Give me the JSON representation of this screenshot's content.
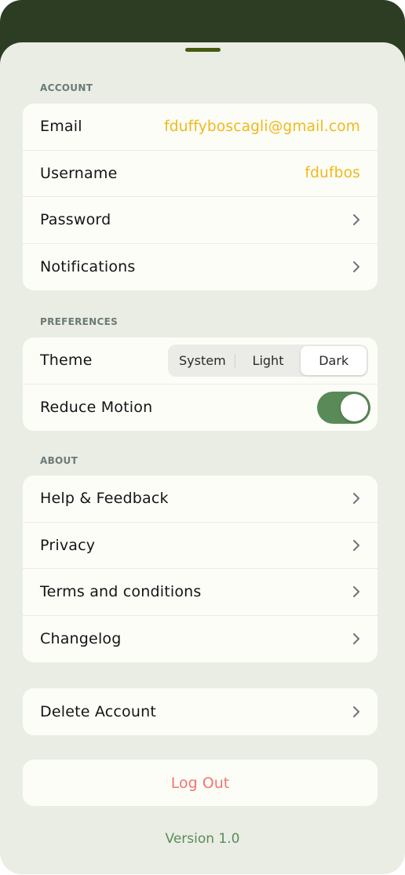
{
  "sections": {
    "account": {
      "title": "ACCOUNT",
      "rows": [
        {
          "label": "Email",
          "value": "fduffyboscagli@gmail.com"
        },
        {
          "label": "Username",
          "value": "fdufbos"
        },
        {
          "label": "Password"
        },
        {
          "label": "Notifications"
        }
      ]
    },
    "preferences": {
      "title": "PREFERENCES",
      "theme": {
        "label": "Theme",
        "options": [
          "System",
          "Light",
          "Dark"
        ],
        "selected": "Dark"
      },
      "reduce_motion": {
        "label": "Reduce Motion",
        "enabled": true
      }
    },
    "about": {
      "title": "ABOUT",
      "rows": [
        {
          "label": "Help & Feedback"
        },
        {
          "label": "Privacy"
        },
        {
          "label": "Terms and conditions"
        },
        {
          "label": "Changelog"
        }
      ]
    }
  },
  "delete_account": {
    "label": "Delete Account"
  },
  "logout": {
    "label": "Log Out"
  },
  "version": "Version 1.0",
  "colors": {
    "header_bg": "#2c3d24",
    "sheet_bg": "#e9ede4",
    "card_bg": "#fdfdf8",
    "value_accent": "#f1b819",
    "toggle_on": "#5a8a58",
    "logout_red": "#f27474",
    "version_green": "#5b8a5a",
    "handle": "#455a13"
  }
}
